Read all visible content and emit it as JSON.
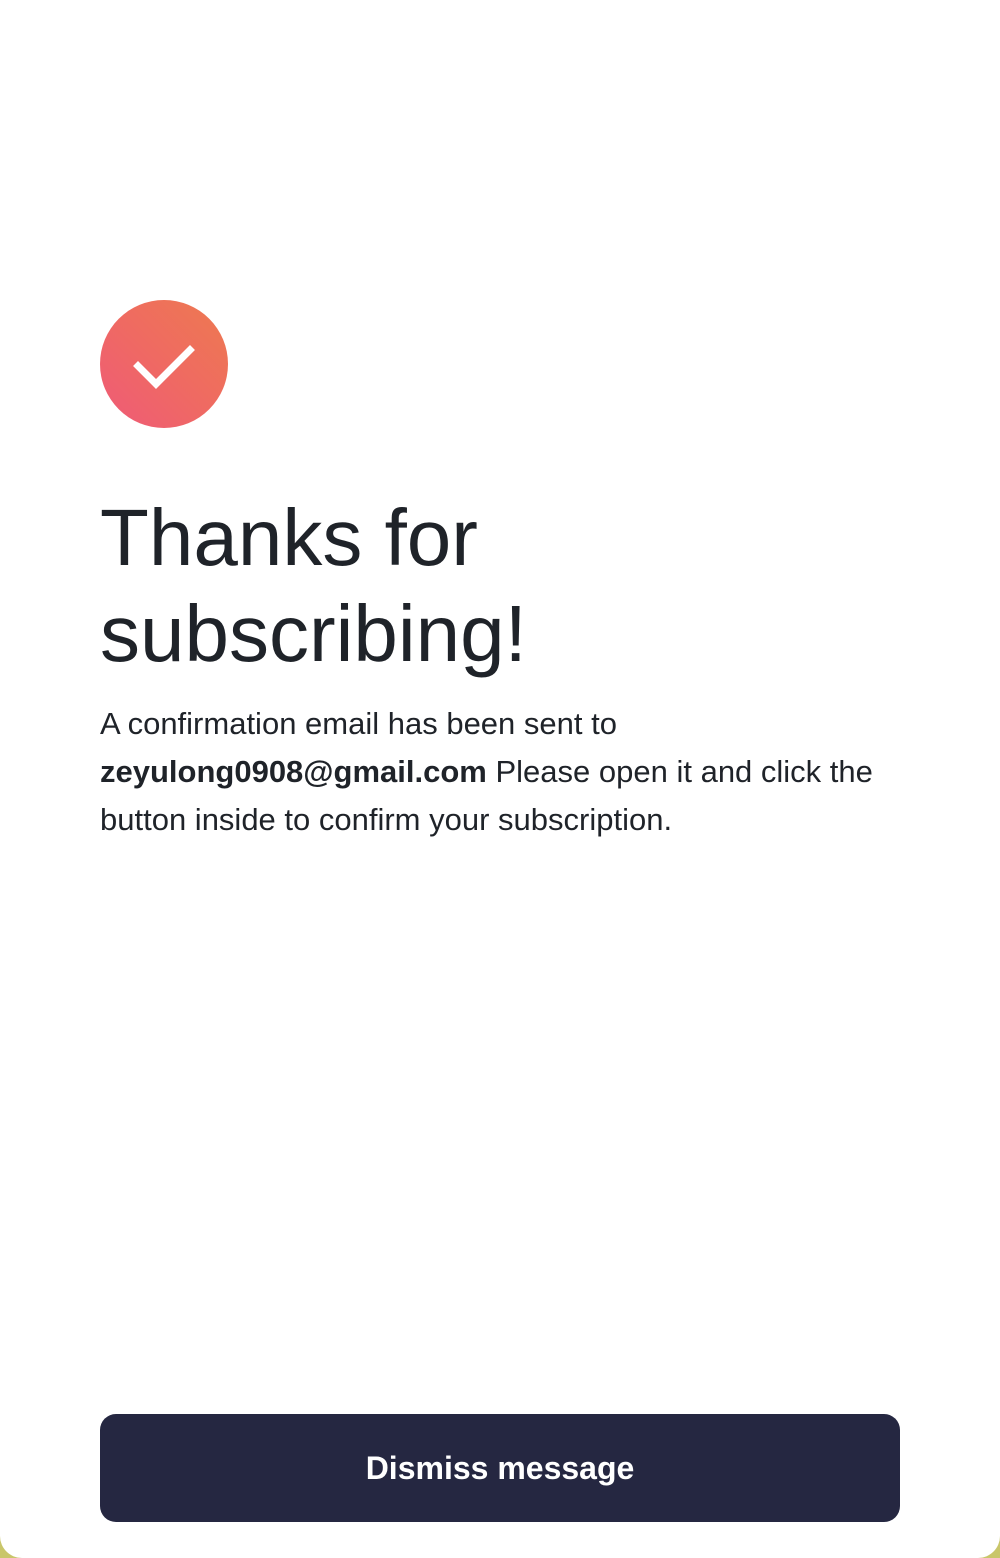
{
  "confirmation": {
    "icon": "checkmark-icon",
    "title_line1": "Thanks for",
    "title_line2": "subscribing!",
    "message_before": "A confirmation email has been sent to",
    "email": "zeyulong0908@gmail.com",
    "message_after": "Please open it and click the button inside to confirm your subscription.",
    "dismiss_label": "Dismiss message"
  },
  "colors": {
    "button_bg": "#252741",
    "button_text": "#ffffff",
    "badge_gradient_start": "#ee7a50",
    "badge_gradient_end": "#ef5a78",
    "text": "#1f2329",
    "background": "#ffffff"
  }
}
